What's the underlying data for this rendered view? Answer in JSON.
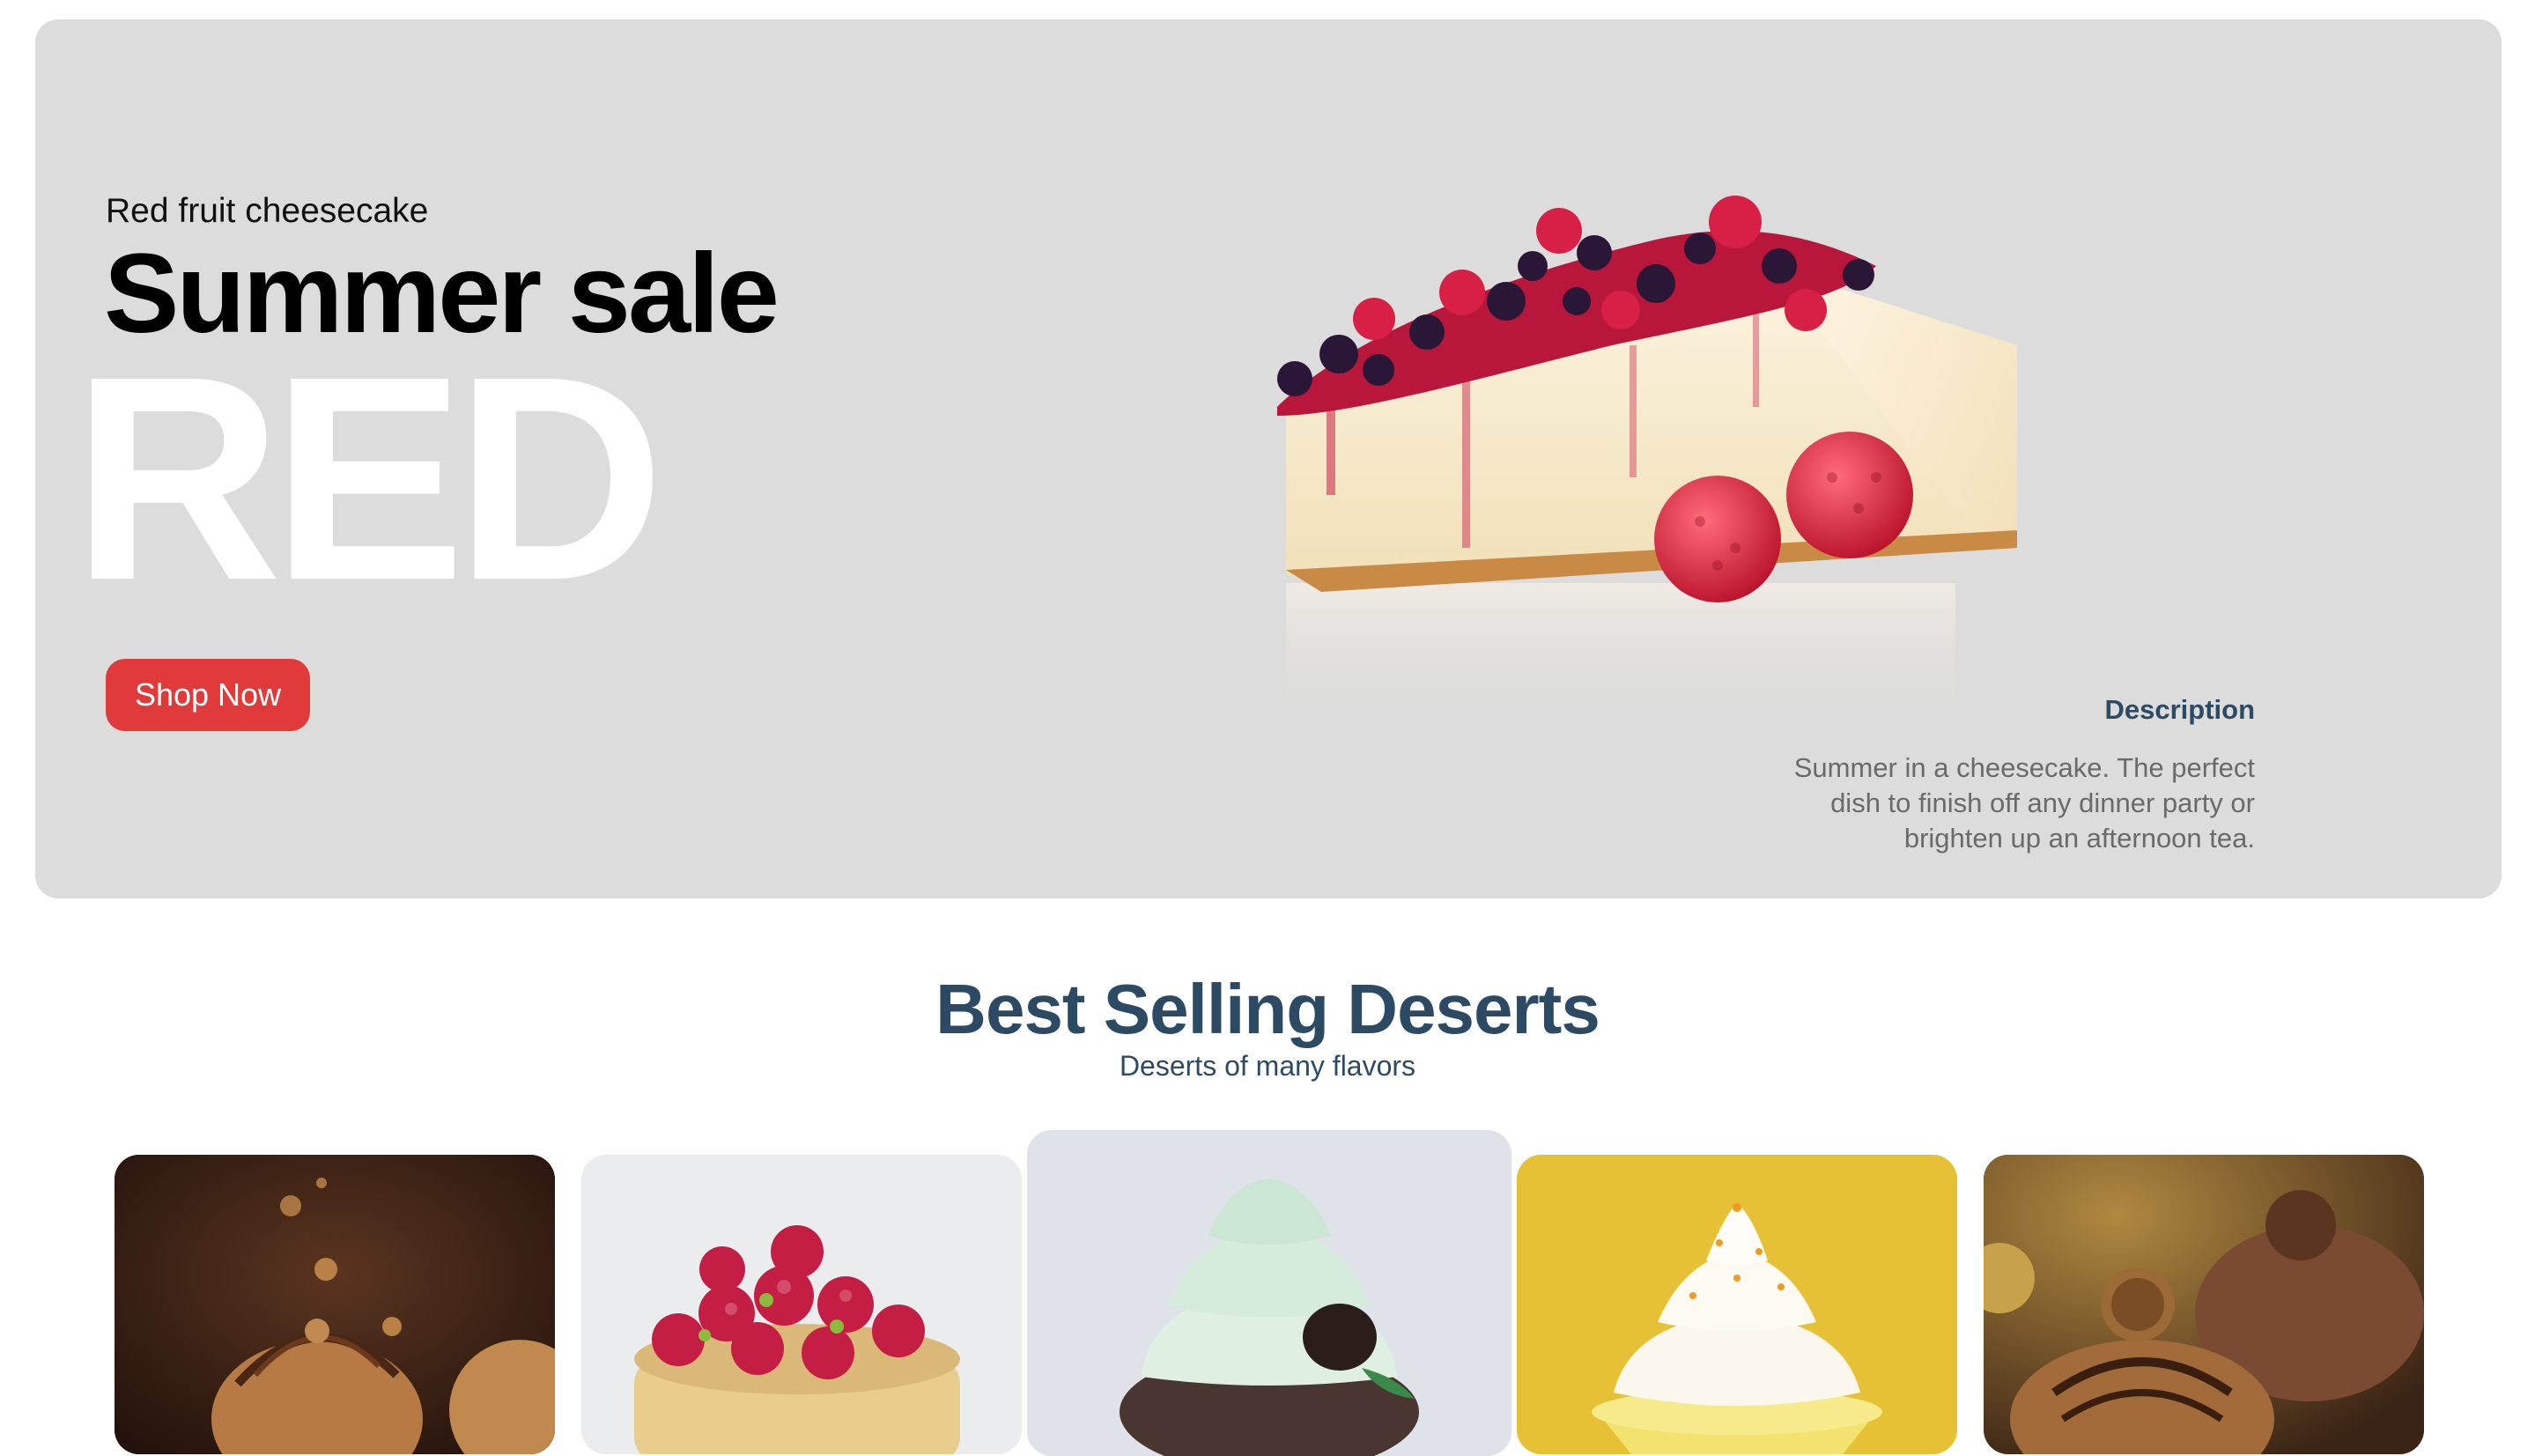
{
  "hero": {
    "subtitle": "Red fruit cheesecake",
    "title": "Summer sale",
    "big_word": "RED",
    "cta_label": "Shop Now",
    "description_title": "Description",
    "description_text": "Summer in a cheesecake. The perfect dish to finish off any dinner party or brighten up an afternoon tea.",
    "hero_image": "cheesecake-with-berries",
    "colors": {
      "background": "#dcdcdc",
      "cta": "#e03a3a",
      "accent_text": "#2d4a64"
    }
  },
  "best_selling": {
    "title": "Best Selling Deserts",
    "subtitle": "Deserts of many flavors",
    "products": [
      {
        "image": "chocolate-hazelnut-choux"
      },
      {
        "image": "raspberry-tart"
      },
      {
        "image": "mint-chocolate-cupcake"
      },
      {
        "image": "lemon-meringue-cupcake"
      },
      {
        "image": "ferrero-chocolate-cupcake"
      }
    ]
  }
}
